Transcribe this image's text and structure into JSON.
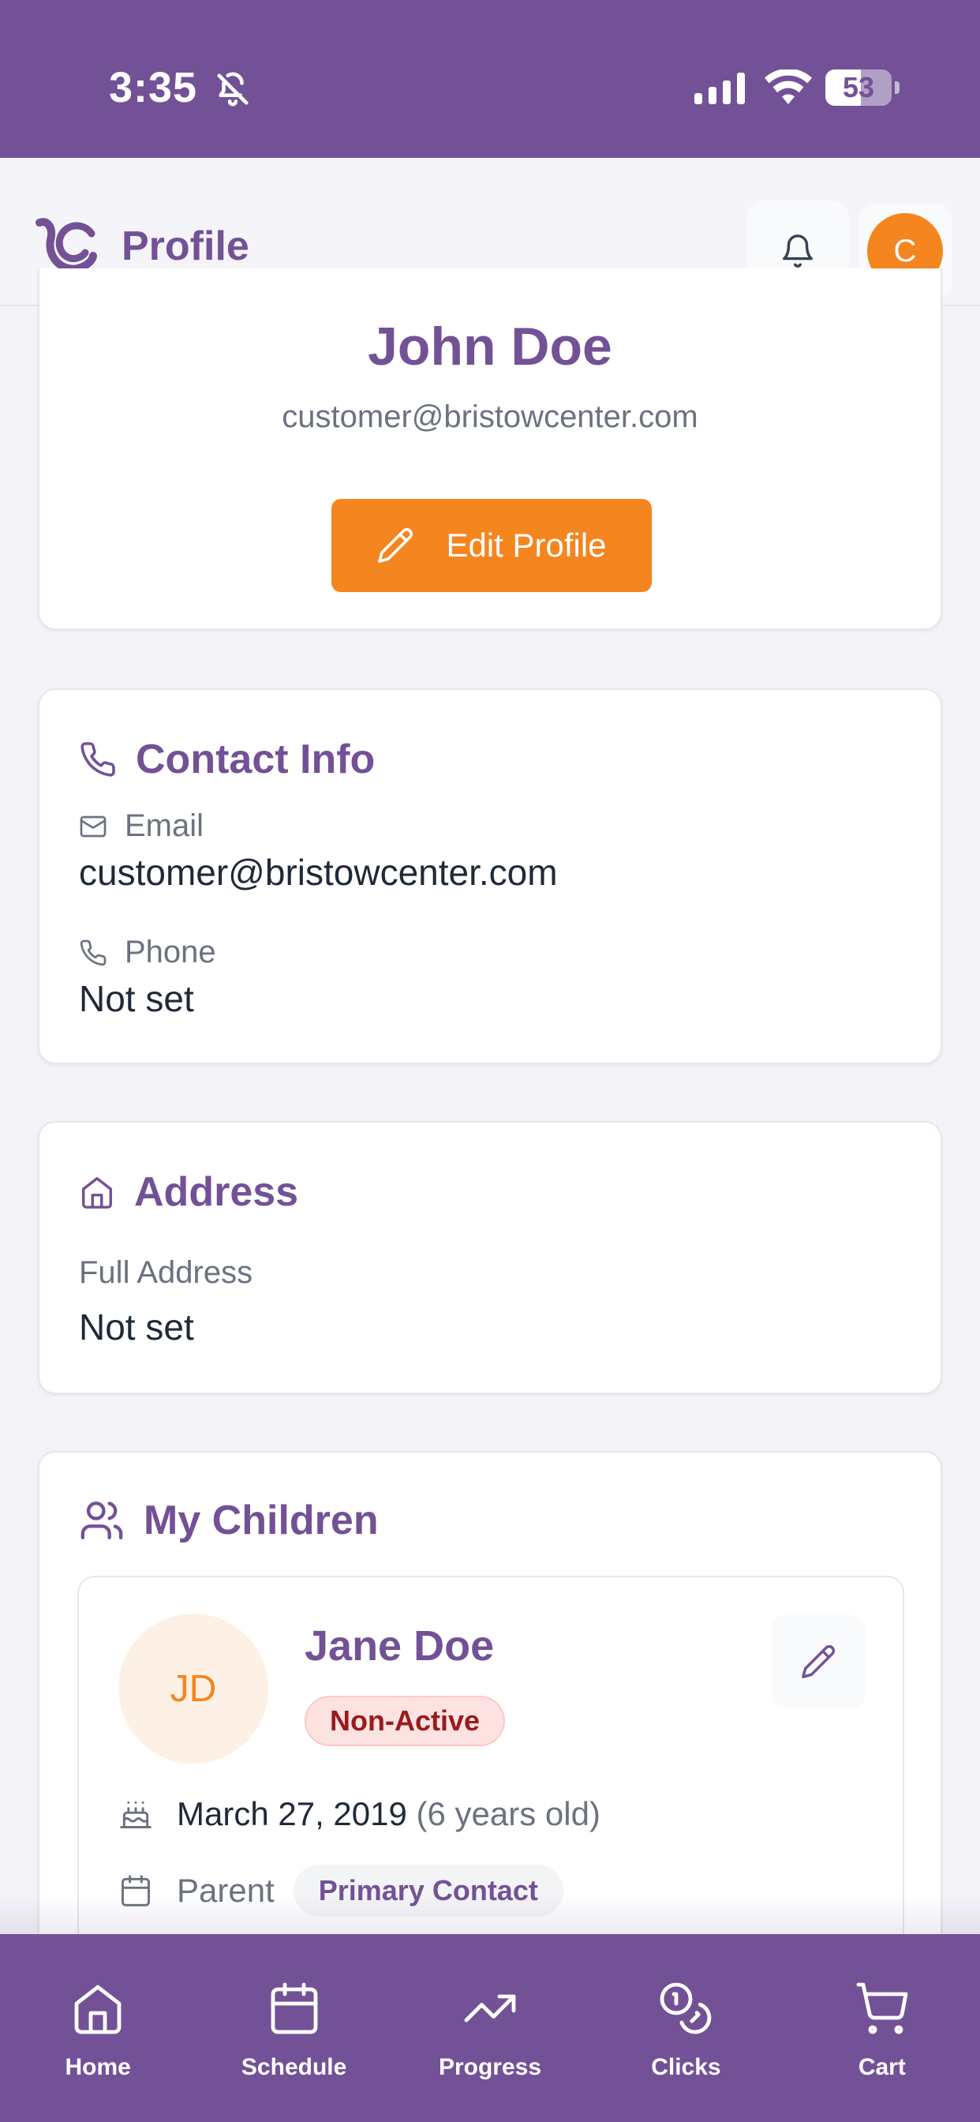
{
  "status_bar": {
    "time": "3:35",
    "battery": "53",
    "battery_level": 0.53
  },
  "header": {
    "title": "Profile",
    "avatar_initial": "C"
  },
  "profile": {
    "name": "John Doe",
    "email": "customer@bristowcenter.com",
    "edit_label": "Edit Profile"
  },
  "contact": {
    "title": "Contact Info",
    "email_label": "Email",
    "email_value": "customer@bristowcenter.com",
    "phone_label": "Phone",
    "phone_value": "Not set"
  },
  "address": {
    "title": "Address",
    "label": "Full Address",
    "value": "Not set"
  },
  "children": {
    "title": "My Children",
    "items": [
      {
        "initials": "JD",
        "name": "Jane Doe",
        "status": "Non-Active",
        "dob": "March 27, 2019",
        "age": "(6 years old)",
        "relation": "Parent",
        "role": "Primary Contact"
      }
    ]
  },
  "nav": {
    "items": [
      {
        "label": "Home",
        "icon": "home-icon"
      },
      {
        "label": "Schedule",
        "icon": "calendar-icon"
      },
      {
        "label": "Progress",
        "icon": "trending-up-icon"
      },
      {
        "label": "Clicks",
        "icon": "coins-icon"
      },
      {
        "label": "Cart",
        "icon": "cart-icon"
      }
    ]
  },
  "colors": {
    "brand": "#735196",
    "accent": "#f5851e",
    "danger": "#991b1b"
  }
}
